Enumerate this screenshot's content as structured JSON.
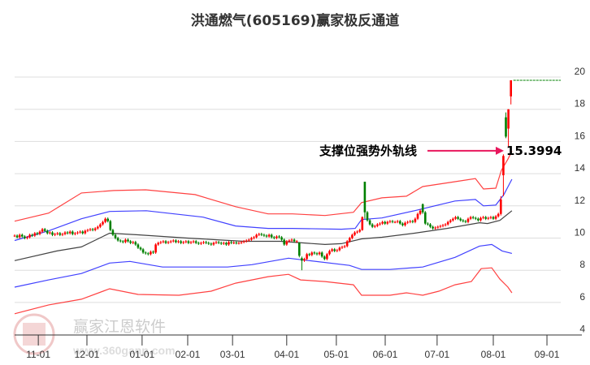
{
  "chart_data": {
    "type": "candlestick",
    "title": "洪通燃气(605169)赢家极反通道",
    "ylim": [
      4,
      20
    ],
    "yticks": [
      4,
      6,
      8,
      10,
      12,
      14,
      16,
      18,
      20
    ],
    "xlim": [
      0,
      218
    ],
    "xticks": [
      {
        "label": "11-01",
        "index": 9.4
      },
      {
        "label": "12-01",
        "index": 28.7
      },
      {
        "label": "01-01",
        "index": 50.6
      },
      {
        "label": "02-01",
        "index": 68.7
      },
      {
        "label": "03-01",
        "index": 86.5
      },
      {
        "label": "04-01",
        "index": 108
      },
      {
        "label": "05-01",
        "index": 127.7
      },
      {
        "label": "06-01",
        "index": 147.1
      },
      {
        "label": "07-01",
        "index": 167.7
      },
      {
        "label": "08-01",
        "index": 190
      },
      {
        "label": "09-01",
        "index": 211.3
      }
    ],
    "closes": [
      10.15,
      10.05,
      10.2,
      10.1,
      10.0,
      10.05,
      10.2,
      10.15,
      10.3,
      10.25,
      10.4,
      10.55,
      10.45,
      10.3,
      10.35,
      10.2,
      10.25,
      10.3,
      10.2,
      10.25,
      10.35,
      10.3,
      10.4,
      10.25,
      10.3,
      10.35,
      10.4,
      10.3,
      10.45,
      10.5,
      10.55,
      10.5,
      10.6,
      10.7,
      10.85,
      11.0,
      11.2,
      11.05,
      10.5,
      10.2,
      10.0,
      9.85,
      9.8,
      9.75,
      9.9,
      9.8,
      9.7,
      9.75,
      9.6,
      9.4,
      9.3,
      9.1,
      9.05,
      9.0,
      9.15,
      9.1,
      9.6,
      9.7,
      9.75,
      9.8,
      9.7,
      9.75,
      9.8,
      9.85,
      9.75,
      9.8,
      9.7,
      9.75,
      9.8,
      9.7,
      9.75,
      9.8,
      9.7,
      9.65,
      9.7,
      9.75,
      9.7,
      9.65,
      9.6,
      9.7,
      9.75,
      9.7,
      9.65,
      9.7,
      9.6,
      9.75,
      9.7,
      9.72,
      9.68,
      9.7,
      9.75,
      9.8,
      9.85,
      9.9,
      10.0,
      10.05,
      10.2,
      10.25,
      10.2,
      10.15,
      10.1,
      10.2,
      10.05,
      10.0,
      10.1,
      10.05,
      9.9,
      9.6,
      9.8,
      9.85,
      9.9,
      9.8,
      9.8,
      8.9,
      8.6,
      8.7,
      9.0,
      8.95,
      9.1,
      9.05,
      9.0,
      9.1,
      8.85,
      8.7,
      9.0,
      9.2,
      9.3,
      9.2,
      9.25,
      9.4,
      9.45,
      9.5,
      9.8,
      10.0,
      10.2,
      10.35,
      10.4,
      10.5,
      11.3,
      11.6,
      11.1,
      10.85,
      10.7,
      10.75,
      10.85,
      10.9,
      11.0,
      10.9,
      11.0,
      11.05,
      11.0,
      11.0,
      11.05,
      10.9,
      10.8,
      10.95,
      11.0,
      11.05,
      11.0,
      11.2,
      11.5,
      11.7,
      11.6,
      10.9,
      10.85,
      10.7,
      10.6,
      10.65,
      10.7,
      10.75,
      10.8,
      10.85,
      11.0,
      11.1,
      11.2,
      11.3,
      11.2,
      11.1,
      11.05,
      11.0,
      11.2,
      11.3,
      11.25,
      11.2,
      11.1,
      11.25,
      11.3,
      11.2,
      11.25,
      11.3,
      11.2,
      11.35,
      11.5,
      12.4,
      15.1,
      16.3,
      18.0,
      19.8
    ],
    "ohlc_overrides": {
      "113": [
        9.7,
        8.9,
        9.75,
        8.8
      ],
      "114": [
        8.75,
        8.6,
        8.85,
        8.0
      ],
      "138": [
        10.5,
        11.3,
        11.35,
        10.45
      ],
      "139": [
        13.5,
        11.6,
        13.5,
        11.2
      ],
      "162": [
        12.1,
        11.6,
        12.15,
        11.5
      ],
      "193": [
        11.5,
        12.4,
        12.6,
        11.4
      ],
      "194": [
        13.9,
        15.1,
        15.2,
        12.6
      ],
      "195": [
        17.5,
        16.3,
        17.8,
        16.2
      ],
      "196": [
        16.8,
        18.0,
        18.0,
        15.7
      ],
      "197": [
        18.8,
        19.8,
        19.8,
        18.3
      ]
    },
    "bands": [
      {
        "name": "upper-outer",
        "color": "#ff2020",
        "points": [
          [
            0,
            11.05
          ],
          [
            13.5,
            11.55
          ],
          [
            26.5,
            12.8
          ],
          [
            39.4,
            12.95
          ],
          [
            52,
            13.0
          ],
          [
            71.6,
            12.7
          ],
          [
            87.7,
            11.95
          ],
          [
            100.6,
            11.5
          ],
          [
            110.3,
            11.5
          ],
          [
            123.2,
            11.4
          ],
          [
            134.5,
            11.6
          ],
          [
            137.7,
            12.2
          ],
          [
            145.8,
            12.5
          ],
          [
            155.5,
            12.6
          ],
          [
            162,
            13.2
          ],
          [
            174.8,
            13.5
          ],
          [
            182.9,
            13.7
          ],
          [
            186.1,
            13.05
          ],
          [
            191,
            13.1
          ],
          [
            193.2,
            14.2
          ],
          [
            195.8,
            14.9
          ],
          [
            197.4,
            15.4
          ]
        ]
      },
      {
        "name": "upper-inner",
        "color": "#2020ff",
        "points": [
          [
            0,
            9.85
          ],
          [
            13.5,
            10.45
          ],
          [
            26.5,
            11.2
          ],
          [
            37.7,
            11.65
          ],
          [
            52.3,
            11.7
          ],
          [
            74.8,
            11.3
          ],
          [
            87.7,
            10.75
          ],
          [
            100.6,
            10.6
          ],
          [
            110.3,
            10.6
          ],
          [
            129.7,
            10.55
          ],
          [
            135.2,
            10.6
          ],
          [
            137.7,
            11.15
          ],
          [
            145.8,
            11.25
          ],
          [
            158.7,
            11.7
          ],
          [
            174.8,
            12.3
          ],
          [
            182.9,
            12.4
          ],
          [
            186.1,
            12.0
          ],
          [
            191,
            12.05
          ],
          [
            194.2,
            12.7
          ],
          [
            197.4,
            13.65
          ]
        ]
      },
      {
        "name": "middle",
        "color": "#222222",
        "points": [
          [
            0,
            8.6
          ],
          [
            16.8,
            9.2
          ],
          [
            26.5,
            9.45
          ],
          [
            37.7,
            10.3
          ],
          [
            49,
            10.2
          ],
          [
            68.4,
            10.0
          ],
          [
            91,
            9.8
          ],
          [
            105.5,
            9.8
          ],
          [
            123.2,
            9.6
          ],
          [
            129.7,
            9.65
          ],
          [
            137.7,
            9.95
          ],
          [
            145.8,
            10.05
          ],
          [
            158.7,
            10.3
          ],
          [
            171.6,
            10.6
          ],
          [
            184.5,
            10.95
          ],
          [
            187.7,
            10.9
          ],
          [
            192.6,
            11.1
          ],
          [
            197.4,
            11.7
          ]
        ]
      },
      {
        "name": "lower-inner",
        "color": "#2020ff",
        "points": [
          [
            0,
            6.95
          ],
          [
            13.5,
            7.4
          ],
          [
            26.5,
            7.8
          ],
          [
            37.7,
            8.45
          ],
          [
            45.8,
            8.55
          ],
          [
            58.7,
            8.2
          ],
          [
            84.5,
            8.2
          ],
          [
            94.2,
            8.35
          ],
          [
            108.7,
            8.75
          ],
          [
            116.8,
            8.6
          ],
          [
            132.9,
            8.3
          ],
          [
            137.7,
            8.05
          ],
          [
            149,
            8.05
          ],
          [
            162,
            8.2
          ],
          [
            174.8,
            8.8
          ],
          [
            184.5,
            9.5
          ],
          [
            189.4,
            9.6
          ],
          [
            193.5,
            9.2
          ],
          [
            197.4,
            9.05
          ]
        ]
      },
      {
        "name": "lower-outer",
        "color": "#ff2020",
        "points": [
          [
            0,
            5.3
          ],
          [
            13.5,
            5.85
          ],
          [
            26.5,
            6.2
          ],
          [
            37.7,
            6.85
          ],
          [
            49,
            6.5
          ],
          [
            65.2,
            6.45
          ],
          [
            78,
            6.7
          ],
          [
            87.7,
            7.2
          ],
          [
            100.6,
            7.6
          ],
          [
            108.7,
            7.75
          ],
          [
            113.5,
            7.4
          ],
          [
            123.2,
            7.3
          ],
          [
            134.5,
            7.1
          ],
          [
            137.7,
            6.45
          ],
          [
            149,
            6.45
          ],
          [
            155.5,
            6.6
          ],
          [
            162,
            6.45
          ],
          [
            168.4,
            6.7
          ],
          [
            174.8,
            7.1
          ],
          [
            181.3,
            7.3
          ],
          [
            185.2,
            8.1
          ],
          [
            189.4,
            8.15
          ],
          [
            192.6,
            7.45
          ],
          [
            195.8,
            6.95
          ],
          [
            197.4,
            6.6
          ]
        ]
      }
    ],
    "last_price_line": 19.8,
    "annotation": {
      "label": "支撑位强势外轨线",
      "value": "15.3994",
      "price": 15.3994
    },
    "colors": {
      "up": "#ff0000",
      "down": "#008000",
      "grid": "#dddddd",
      "arrow": "#e8175d",
      "last_line": "#008000"
    }
  },
  "watermark": {
    "brand": "赢家江恩软件",
    "url": "www.360gann.com",
    "seal": "江赢恩家"
  }
}
